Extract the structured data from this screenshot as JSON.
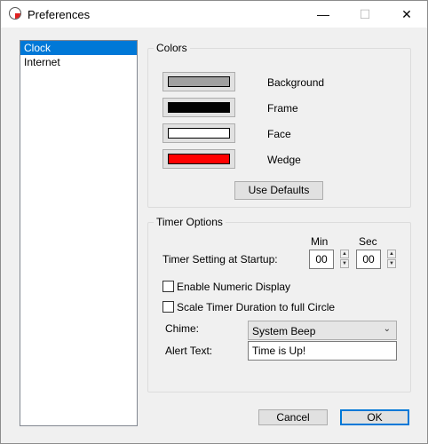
{
  "window": {
    "title": "Preferences",
    "controls": {
      "minimize": "—",
      "maximize": "☐",
      "close": "✕"
    }
  },
  "sidebar": {
    "items": [
      {
        "label": "Clock",
        "selected": true
      },
      {
        "label": "Internet",
        "selected": false
      }
    ]
  },
  "colors": {
    "group_label": "Colors",
    "swatches": [
      {
        "label": "Background",
        "color": "#a0a0a0"
      },
      {
        "label": "Frame",
        "color": "#000000"
      },
      {
        "label": "Face",
        "color": "#ffffff"
      },
      {
        "label": "Wedge",
        "color": "#ff0000"
      }
    ],
    "use_defaults_label": "Use Defaults"
  },
  "timer": {
    "group_label": "Timer Options",
    "min_header": "Min",
    "sec_header": "Sec",
    "startup_label": "Timer Setting at Startup:",
    "min_value": "00",
    "sec_value": "00",
    "numeric_display_label": "Enable Numeric Display",
    "numeric_display_checked": false,
    "scale_label": "Scale Timer Duration to full Circle",
    "scale_checked": false,
    "chime_label": "Chime:",
    "chime_value": "System Beep",
    "alert_label": "Alert Text:",
    "alert_value": "Time is Up!"
  },
  "footer": {
    "cancel_label": "Cancel",
    "ok_label": "OK"
  },
  "accent_color": "#0078d7"
}
